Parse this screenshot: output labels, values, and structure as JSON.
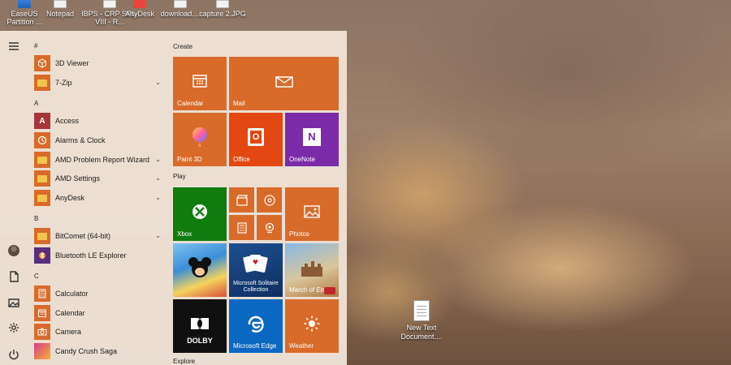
{
  "desktop": {
    "icons": [
      {
        "label": "EaseUS Partition ...",
        "icon": "easeus-icon"
      },
      {
        "label": "Notepad",
        "icon": "notepad-icon"
      },
      {
        "label": "IBPS - CRP SPL-VIII - R...",
        "icon": "document-icon"
      },
      {
        "label": "AnyDesk",
        "icon": "anydesk-icon"
      },
      {
        "label": "download....",
        "icon": "image-file-icon"
      },
      {
        "label": "capture 2.JPG",
        "icon": "image-file-icon"
      }
    ],
    "file": {
      "label": "New Text Document....",
      "icon": "text-file-icon"
    }
  },
  "start_menu": {
    "rail": [
      {
        "name": "hamburger-menu",
        "icon": "hamburger-icon"
      },
      {
        "name": "user-account",
        "icon": "avatar-icon"
      },
      {
        "name": "documents",
        "icon": "document-icon"
      },
      {
        "name": "pictures",
        "icon": "pictures-icon"
      },
      {
        "name": "settings",
        "icon": "gear-icon"
      },
      {
        "name": "power",
        "icon": "power-icon"
      }
    ],
    "letters": [
      "#",
      "A",
      "B",
      "C"
    ],
    "apps": [
      {
        "label": "3D Viewer",
        "icon": "3d-viewer-icon"
      },
      {
        "label": "7-Zip",
        "icon": "folder-icon",
        "expand": "⌄"
      },
      {
        "label": "Access",
        "icon": "access-icon",
        "glyph": "A"
      },
      {
        "label": "Alarms & Clock",
        "icon": "clock-icon"
      },
      {
        "label": "AMD Problem Report Wizard",
        "icon": "folder-icon",
        "expand": "⌄"
      },
      {
        "label": "AMD Settings",
        "icon": "folder-icon",
        "expand": "⌄"
      },
      {
        "label": "AnyDesk",
        "icon": "folder-icon",
        "expand": "⌄"
      },
      {
        "label": "BitComet (64-bit)",
        "icon": "folder-icon",
        "expand": "⌄"
      },
      {
        "label": "Bluetooth LE Explorer",
        "icon": "bluetooth-explorer-icon"
      },
      {
        "label": "Calculator",
        "icon": "calculator-icon"
      },
      {
        "label": "Calendar",
        "icon": "calendar-icon"
      },
      {
        "label": "Camera",
        "icon": "camera-icon"
      },
      {
        "label": "Candy Crush Saga",
        "icon": "candy-crush-icon"
      }
    ],
    "groups": {
      "create": "Create",
      "play": "Play",
      "explore": "Explore"
    },
    "tiles": {
      "calendar": "Calendar",
      "mail": "Mail",
      "paint3d": "Paint 3D",
      "office": "Office",
      "onenote": "OneNote",
      "xbox": "Xbox",
      "photos": "Photos",
      "solitaire": "Microsoft Solitaire Collection",
      "march": "March of Em...",
      "edge": "Microsoft Edge",
      "weather": "Weather",
      "dolby": "DOLBY",
      "onenote_glyph": "N",
      "office_glyph": "O"
    }
  },
  "colors": {
    "tile_orange": "#d86b2a",
    "office_red": "#e34813",
    "onenote_purple": "#7b2aa8",
    "xbox_green": "#107c10",
    "edge_blue": "#0a67c2"
  }
}
